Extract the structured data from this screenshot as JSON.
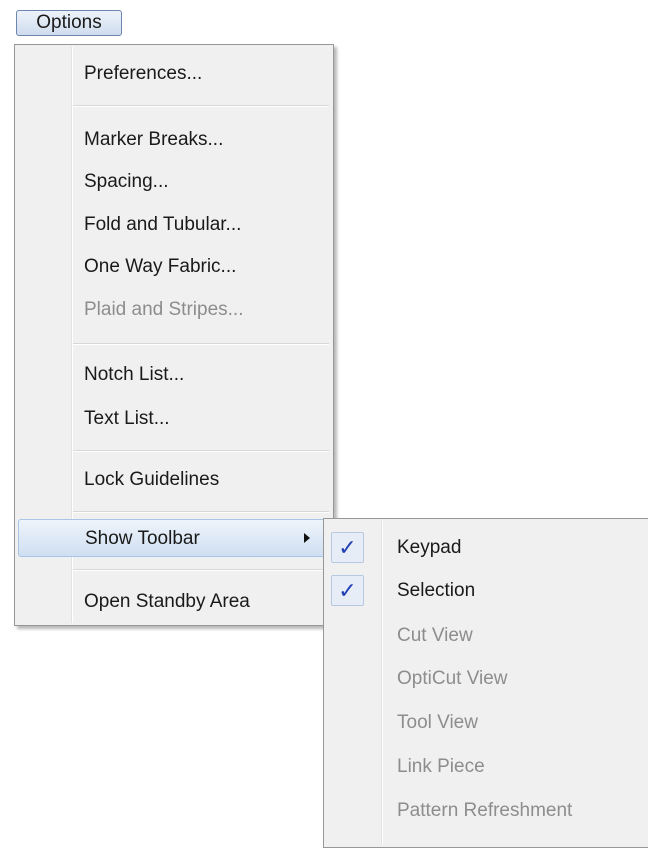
{
  "menubar": {
    "options_label": "Options"
  },
  "menu": {
    "items": [
      {
        "label": "Preferences...",
        "disabled": false
      },
      {
        "label": "Marker Breaks...",
        "disabled": false
      },
      {
        "label": "Spacing...",
        "disabled": false
      },
      {
        "label": "Fold and Tubular...",
        "disabled": false
      },
      {
        "label": "One Way Fabric...",
        "disabled": false
      },
      {
        "label": "Plaid and Stripes...",
        "disabled": true
      },
      {
        "label": "Notch List...",
        "disabled": false
      },
      {
        "label": "Text List...",
        "disabled": false
      },
      {
        "label": "Lock Guidelines",
        "disabled": false
      },
      {
        "label": "Show Toolbar",
        "disabled": false,
        "highlighted": true,
        "submenu_arrow": "triangle-right-icon"
      },
      {
        "label": "Open Standby Area",
        "disabled": false
      }
    ]
  },
  "submenu": {
    "check_glyph": "✓",
    "items": [
      {
        "label": "Keypad",
        "checked": true,
        "disabled": false
      },
      {
        "label": "Selection",
        "checked": true,
        "disabled": false
      },
      {
        "label": "Cut View",
        "checked": false,
        "disabled": true
      },
      {
        "label": "OptiCut View",
        "checked": false,
        "disabled": true
      },
      {
        "label": "Tool View",
        "checked": false,
        "disabled": true
      },
      {
        "label": "Link Piece",
        "checked": false,
        "disabled": true
      },
      {
        "label": "Pattern Refreshment",
        "checked": false,
        "disabled": true
      }
    ]
  },
  "colors": {
    "highlight": "#cfdff1",
    "disabled_text": "#8d8d8d",
    "checkmark": "#1f3fb3"
  }
}
